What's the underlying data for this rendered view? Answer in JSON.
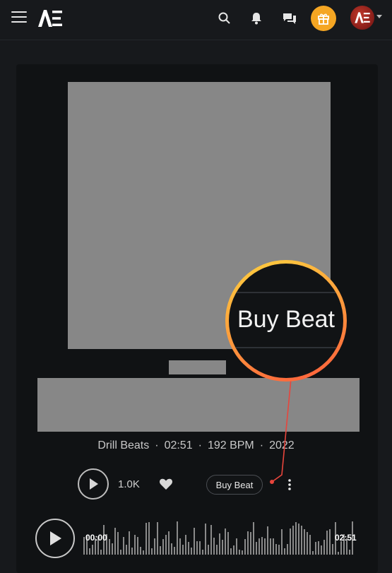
{
  "header": {
    "logo_text": "AE",
    "icons": [
      "menu-icon",
      "search-icon",
      "bell-icon",
      "chat-icon",
      "gift-icon",
      "avatar"
    ]
  },
  "beat": {
    "meta": {
      "genre": "Drill Beats",
      "duration": "02:51",
      "bpm": "192 BPM",
      "year": "2022"
    },
    "plays": "1.0K",
    "buy_label": "Buy Beat"
  },
  "player": {
    "time_start": "00:00",
    "time_end": "02:51"
  },
  "callout": {
    "text": "Buy Beat"
  },
  "colors": {
    "accent_orange": "#f5a623",
    "background": "#17191c",
    "card": "#101214",
    "placeholder": "#878787",
    "callout_red": "#e8453c"
  }
}
